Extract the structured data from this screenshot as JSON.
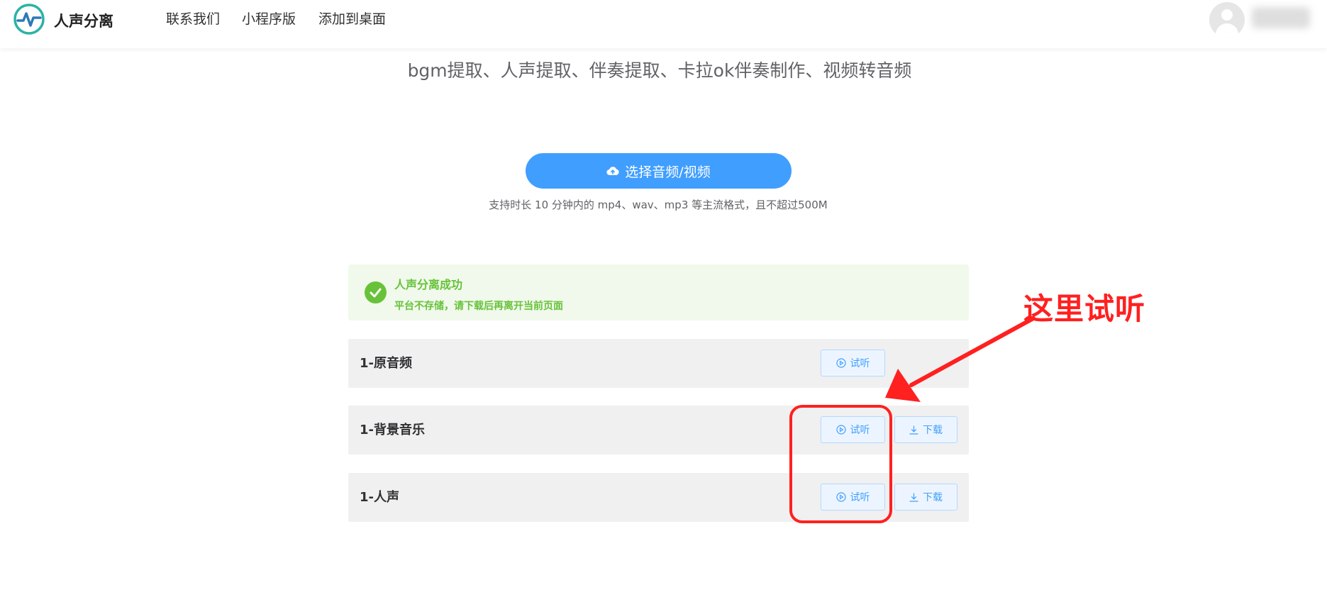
{
  "header": {
    "logo_icon": "waveform-logo-icon",
    "brand": "人声分离",
    "nav": [
      "联系我们",
      "小程序版",
      "添加到桌面"
    ],
    "avatar_icon": "user-avatar-icon"
  },
  "description": {
    "line2": "bgm提取、人声提取、伴奏提取、卡拉ok伴奏制作、视频转音频"
  },
  "upload": {
    "button_label": "选择音频/视频",
    "button_icon": "cloud-upload-icon",
    "hint": "支持时长 10 分钟内的 mp4、wav、mp3 等主流格式，且不超过500M"
  },
  "alert": {
    "icon": "success-check-icon",
    "title": "人声分离成功",
    "description": "平台不存储，请下载后再离开当前页面"
  },
  "results": [
    {
      "title": "1-原音频",
      "play_label": "试听"
    },
    {
      "title": "1-背景音乐",
      "play_label": "试听",
      "download_label": "下载"
    },
    {
      "title": "1-人声",
      "play_label": "试听",
      "download_label": "下载"
    }
  ],
  "annotation": {
    "text": "这里试听",
    "color": "#ff2020"
  },
  "colors": {
    "primary": "#409eff",
    "success": "#67c23a",
    "success_bg": "#f0f9eb",
    "row_bg": "#f0f0f0"
  }
}
